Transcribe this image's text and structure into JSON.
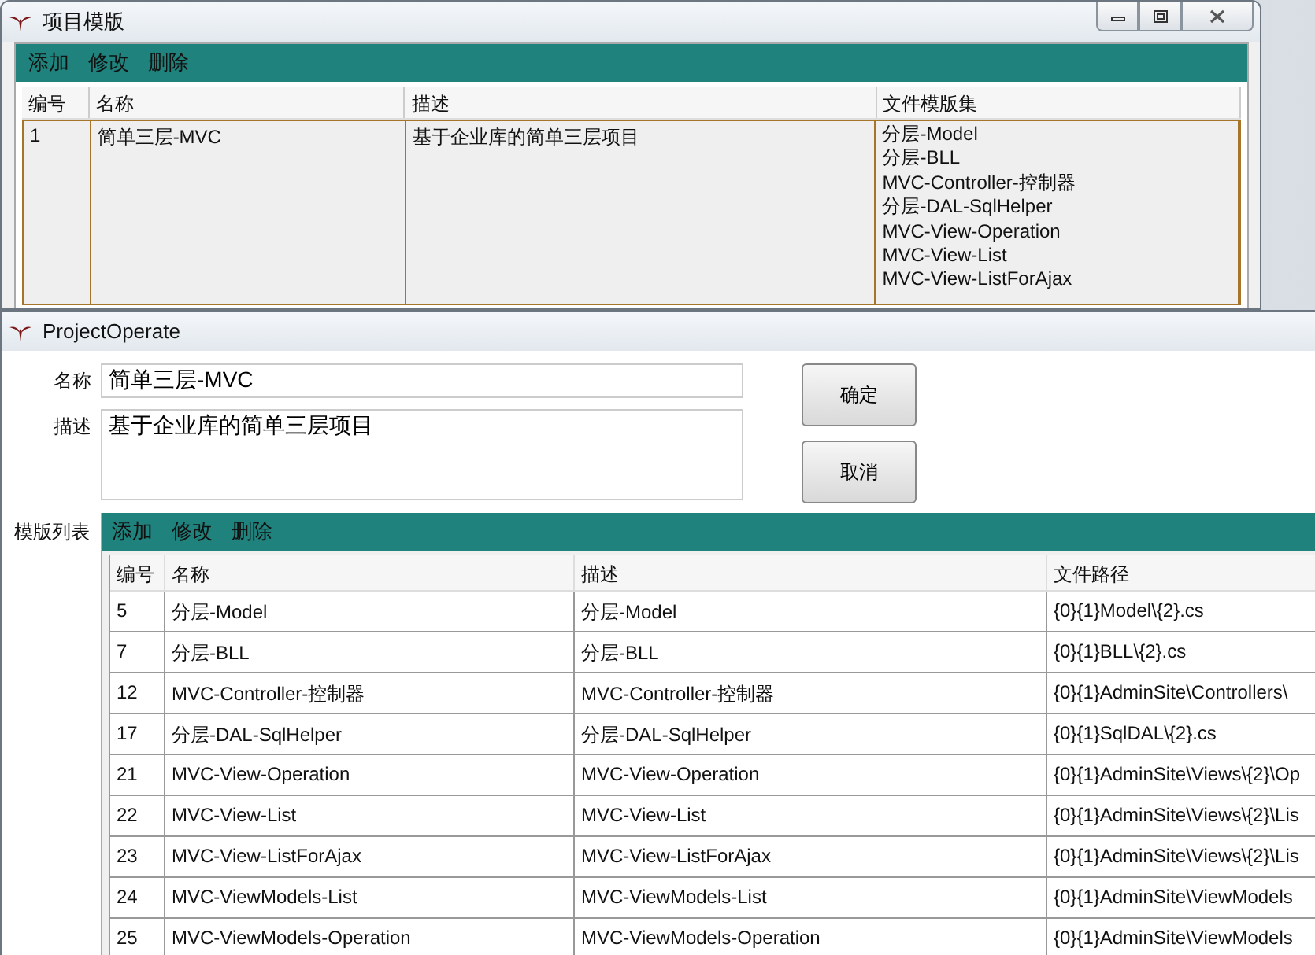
{
  "back_window": {
    "title": "项目模版",
    "toolbar": [
      "添加",
      "修改",
      "删除"
    ],
    "table": {
      "columns": [
        "编号",
        "名称",
        "描述",
        "文件模版集"
      ],
      "rows": [
        {
          "selected": true,
          "cells": [
            "1",
            "简单三层-MVC",
            "基于企业库的简单三层项目"
          ],
          "templates": [
            "分层-Model",
            "分层-BLL",
            "MVC-Controller-控制器",
            "分层-DAL-SqlHelper",
            "MVC-View-Operation",
            "MVC-View-List",
            "MVC-View-ListForAjax"
          ]
        }
      ]
    }
  },
  "front_window": {
    "title": "ProjectOperate",
    "fields": [
      {
        "label": "名称",
        "kind": "line",
        "value": "简单三层-MVC"
      },
      {
        "label": "描述",
        "kind": "area",
        "value": "基于企业库的简单三层项目"
      }
    ],
    "buttons": [
      "确定",
      "取消"
    ],
    "list_label": "模版列表",
    "toolbar": [
      "添加",
      "修改",
      "删除"
    ],
    "table": {
      "columns": [
        "编号",
        "名称",
        "描述",
        "文件路径"
      ],
      "rows": [
        [
          "5",
          "分层-Model",
          "分层-Model",
          "{0}{1}Model\\{2}.cs"
        ],
        [
          "7",
          "分层-BLL",
          "分层-BLL",
          "{0}{1}BLL\\{2}.cs"
        ],
        [
          "12",
          "MVC-Controller-控制器",
          "MVC-Controller-控制器",
          "{0}{1}AdminSite\\Controllers\\"
        ],
        [
          "17",
          "分层-DAL-SqlHelper",
          "分层-DAL-SqlHelper",
          "{0}{1}SqlDAL\\{2}.cs"
        ],
        [
          "21",
          "MVC-View-Operation",
          "MVC-View-Operation",
          "{0}{1}AdminSite\\Views\\{2}\\Op"
        ],
        [
          "22",
          "MVC-View-List",
          "MVC-View-List",
          "{0}{1}AdminSite\\Views\\{2}\\Lis"
        ],
        [
          "23",
          "MVC-View-ListForAjax",
          "MVC-View-ListForAjax",
          "{0}{1}AdminSite\\Views\\{2}\\Lis"
        ],
        [
          "24",
          "MVC-ViewModels-List",
          "MVC-ViewModels-List",
          "{0}{1}AdminSite\\ViewModels"
        ],
        [
          "25",
          "MVC-ViewModels-Operation",
          "MVC-ViewModels-Operation",
          "{0}{1}AdminSite\\ViewModels"
        ]
      ]
    }
  }
}
